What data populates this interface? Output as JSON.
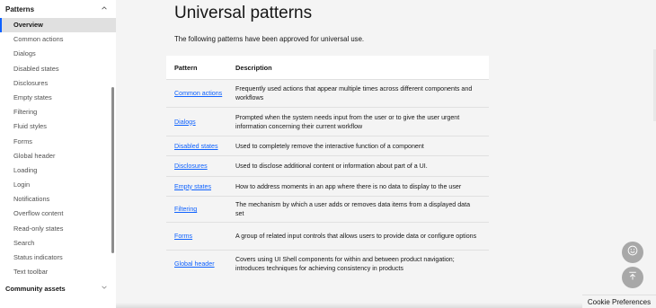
{
  "sidebar": {
    "section_title": "Patterns",
    "items": [
      {
        "label": "Overview",
        "active": true
      },
      {
        "label": "Common actions"
      },
      {
        "label": "Dialogs"
      },
      {
        "label": "Disabled states"
      },
      {
        "label": "Disclosures"
      },
      {
        "label": "Empty states"
      },
      {
        "label": "Filtering"
      },
      {
        "label": "Fluid styles"
      },
      {
        "label": "Forms"
      },
      {
        "label": "Global header"
      },
      {
        "label": "Loading"
      },
      {
        "label": "Login"
      },
      {
        "label": "Notifications"
      },
      {
        "label": "Overflow content"
      },
      {
        "label": "Read-only states"
      },
      {
        "label": "Search"
      },
      {
        "label": "Status indicators"
      },
      {
        "label": "Text toolbar"
      }
    ],
    "next_section_title": "Community assets"
  },
  "main": {
    "title": "Universal patterns",
    "intro": "The following patterns have been approved for universal use.",
    "table": {
      "headers": {
        "pattern": "Pattern",
        "description": "Description"
      },
      "rows": [
        {
          "pattern": "Common actions",
          "description": "Frequently used actions that appear multiple times across different components and workflows"
        },
        {
          "pattern": "Dialogs",
          "description": "Prompted when the system needs input from the user or to give the user urgent information concerning their current workflow"
        },
        {
          "pattern": "Disabled states",
          "description": "Used to completely remove the interactive function of a component"
        },
        {
          "pattern": "Disclosures",
          "description": "Used to disclose additional content or information about part of a UI."
        },
        {
          "pattern": "Empty states",
          "description": "How to address moments in an app where there is no data to display to the user"
        },
        {
          "pattern": "Filtering",
          "description": "The mechanism by which a user adds or removes data items from a displayed data set"
        },
        {
          "pattern": "Forms",
          "description": "A group of related input controls that allows users to provide data or configure options"
        },
        {
          "pattern": "Global header",
          "description": "Covers using UI Shell components for within and between product navigation; introduces techniques for achieving consistency in products"
        }
      ]
    }
  },
  "cookie_label": "Cookie Preferences",
  "icons": {
    "section_toggle": "chevron-up-icon",
    "next_section_toggle": "chevron-down-icon",
    "feedback": "smiley-face-icon",
    "back_to_top": "arrow-up-to-top-icon"
  },
  "colors": {
    "link": "#0f62fe",
    "active_indicator": "#0f62fe",
    "background": "#f4f4f4",
    "fab": "#a8a8a8"
  }
}
